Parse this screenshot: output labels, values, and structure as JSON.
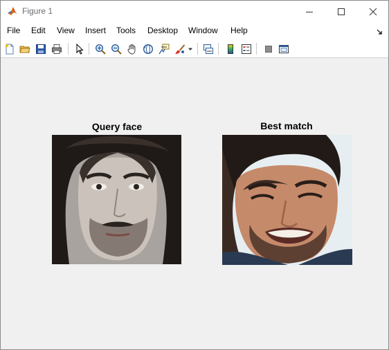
{
  "window": {
    "title": "Figure 1"
  },
  "menu": [
    "File",
    "Edit",
    "View",
    "Insert",
    "Tools",
    "Desktop",
    "Window",
    "Help"
  ],
  "toolbar_icons": [
    "new-figure-icon",
    "open-file-icon",
    "save-icon",
    "print-icon",
    "pointer-icon",
    "zoom-in-icon",
    "zoom-out-icon",
    "pan-icon",
    "rotate-3d-icon",
    "data-cursor-icon",
    "brush-icon",
    "link-plot-icon",
    "colorbar-icon",
    "legend-icon",
    "hide-plot-tools-icon",
    "show-plot-tools-icon"
  ],
  "axes": [
    {
      "title": "Query face",
      "image": "query-face-image"
    },
    {
      "title": "Best match",
      "image": "best-match-face-image"
    }
  ],
  "colors": {
    "figure_bg": "#f0f0f0",
    "chrome_bg": "#ffffff",
    "title_text": "#6d6d6d"
  }
}
